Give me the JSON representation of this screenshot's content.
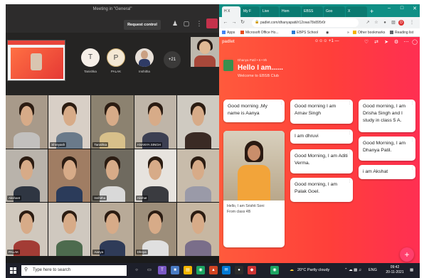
{
  "teams": {
    "meeting_title": "Meeting in \"General\"",
    "request_control": "Request control",
    "participants_strip": [
      {
        "initial": "T",
        "name": "Tanishka",
        "color": "#f6efe8"
      },
      {
        "initial": "P",
        "name": "PALAK",
        "color": "#f4e8d4"
      },
      {
        "initial": "",
        "name": "Inshitha",
        "color": "#e8e0d8"
      }
    ],
    "more_count": "+21",
    "tiles": [
      {
        "name": "",
        "bg": "#a89a8a",
        "body": "#c2c0be"
      },
      {
        "name": "Shreyash",
        "bg": "#d8cfc6",
        "body": "#6a7a8a"
      },
      {
        "name": "Tanishka",
        "bg": "#8c8270",
        "body": "#d8c08a"
      },
      {
        "name": "ANANYA SINGH",
        "bg": "#bfb5a8",
        "body": "#3c3f52"
      },
      {
        "name": "",
        "bg": "#cfcac1",
        "body": "#3a2a24"
      },
      {
        "name": "Akshant",
        "bg": "#b9b3ab",
        "body": "#2f3642"
      },
      {
        "name": "",
        "bg": "#a07d63",
        "body": "#2b3b5a"
      },
      {
        "name": "Inshitha",
        "bg": "#6f6a5f",
        "body": "#d9d9d9"
      },
      {
        "name": "Akshat",
        "bg": "#e7e3de",
        "body": "#3a3b40"
      },
      {
        "name": "",
        "bg": "#c8bcab",
        "body": "#9a9aa8"
      },
      {
        "name": "PALAK",
        "bg": "#d0c8bd",
        "body": "#a33c35"
      },
      {
        "name": "",
        "bg": "#cfc8bf",
        "body": "#4d6b4e"
      },
      {
        "name": "Aanya",
        "bg": "#b8aa98",
        "body": "#2f3b58"
      },
      {
        "name": "Dhnya",
        "bg": "#9d8e7a",
        "body": "#e0e0e0"
      },
      {
        "name": "",
        "bg": "#c7b7a2",
        "body": "#7a6e8a"
      }
    ]
  },
  "browser": {
    "tabs": [
      "H X",
      "My F",
      "Live",
      "Hom",
      "EBSS",
      "Goo",
      "X"
    ],
    "new_tab": "+",
    "url": "padlet.com/dhanyapatil/r12owa78x895r0r",
    "bookmarks": {
      "apps": "Apps",
      "office": "Microsoft Office Ho...",
      "school": "EBPS School",
      "chevron": "»",
      "other": "Other bookmarks",
      "reading": "Reading list"
    }
  },
  "padlet": {
    "logo": "padlet",
    "header_mid": "☺☺☺ +1 —",
    "owner": "Dhanya Patil • 6 • 9h",
    "title": "Hello I am......",
    "subtitle": "Welcome to EBSB Club",
    "col1": {
      "card1": "Good morning ,My name is Aanya",
      "img_caption1": "Hello, I am Srishti Soni",
      "img_caption2": "From class 4B"
    },
    "col2": [
      "Good morning I am Arnav Singh",
      "I am dhruvi",
      "Good Morning, I am Aditi Verma.",
      "Good morning, I am Palak Goel."
    ],
    "col3": [
      "Good morning, I am Drisha Singh and I study in class 5 A.",
      "Good Morning, I am Dhanya Patil.",
      "i am Akshat"
    ],
    "fab": "+"
  },
  "taskbar": {
    "search_placeholder": "Type here to search",
    "weather": "20°C Partly cloudy",
    "lang": "ENG",
    "time": "09:42",
    "date": "20-11-2021"
  }
}
